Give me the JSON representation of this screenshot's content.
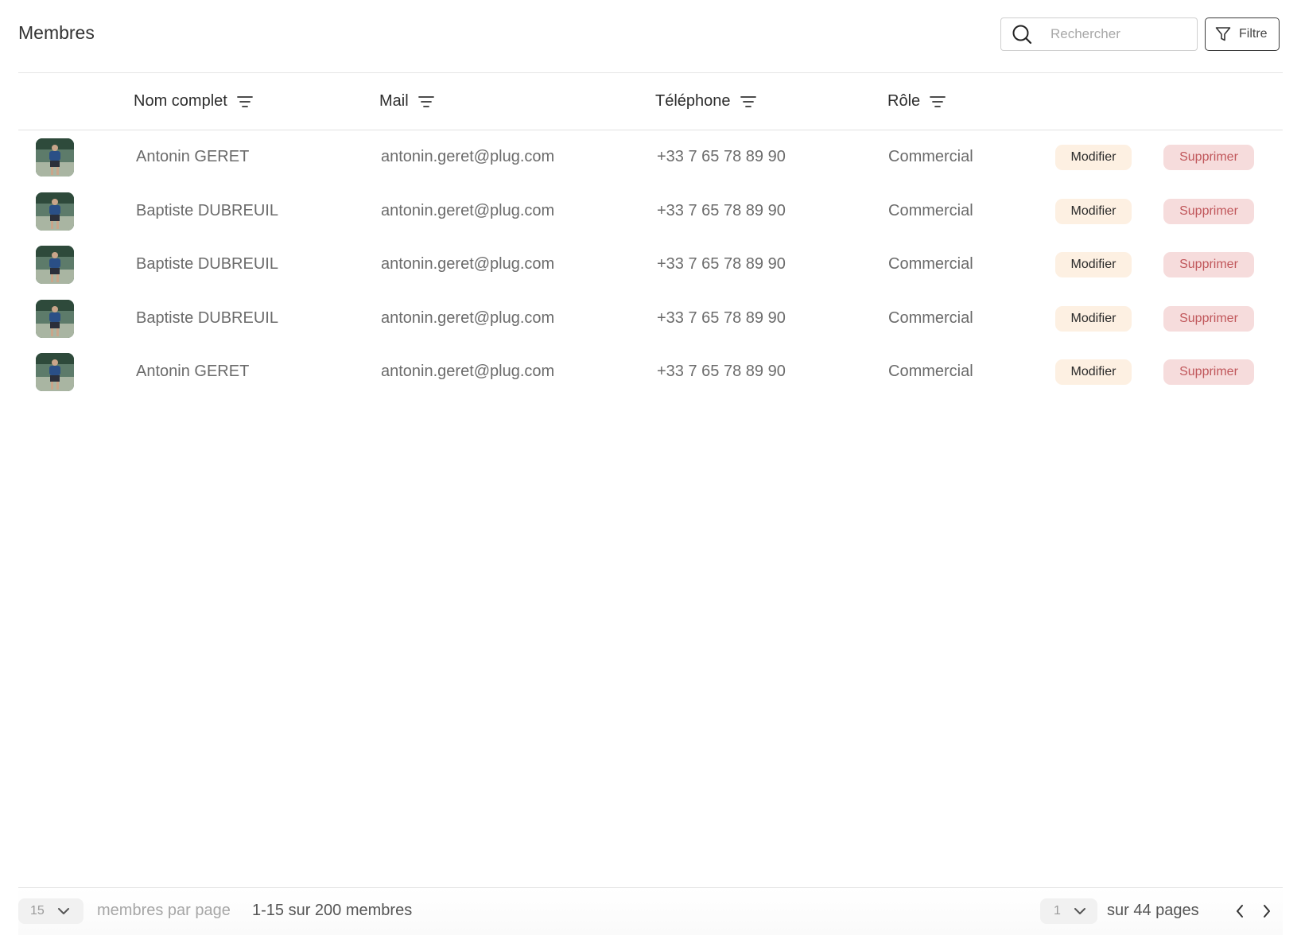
{
  "header": {
    "title": "Membres",
    "search_placeholder": "Rechercher",
    "filter_label": "Filtre"
  },
  "table": {
    "columns": [
      "Nom complet",
      "Mail",
      "Téléphone",
      "Rôle"
    ],
    "rows": [
      {
        "name": "Antonin GERET",
        "mail": "antonin.geret@plug.com",
        "phone": "+33 7 65 78 89 90",
        "role": "Commercial",
        "edit": "Modifier",
        "delete": "Supprimer"
      },
      {
        "name": "Baptiste DUBREUIL",
        "mail": "antonin.geret@plug.com",
        "phone": "+33 7 65 78 89 90",
        "role": "Commercial",
        "edit": "Modifier",
        "delete": "Supprimer"
      },
      {
        "name": "Baptiste DUBREUIL",
        "mail": "antonin.geret@plug.com",
        "phone": "+33 7 65 78 89 90",
        "role": "Commercial",
        "edit": "Modifier",
        "delete": "Supprimer"
      },
      {
        "name": "Baptiste DUBREUIL",
        "mail": "antonin.geret@plug.com",
        "phone": "+33 7 65 78 89 90",
        "role": "Commercial",
        "edit": "Modifier",
        "delete": "Supprimer"
      },
      {
        "name": "Antonin GERET",
        "mail": "antonin.geret@plug.com",
        "phone": "+33 7 65 78 89 90",
        "role": "Commercial",
        "edit": "Modifier",
        "delete": "Supprimer"
      }
    ]
  },
  "footer": {
    "per_page_value": "15",
    "per_page_label": "membres par page",
    "range_text": "1-15 sur 200 membres",
    "page_value": "1",
    "pages_label": "sur 44 pages"
  },
  "colors": {
    "modify_bg": "#fdf0e2",
    "delete_bg": "#f6dcdc",
    "delete_text": "#c0565a"
  },
  "icons": {
    "search": "search-icon",
    "filter": "filter-icon",
    "sort": "sort-lines-icon",
    "chevron": "chevron-down-icon",
    "prev": "chevron-left-icon",
    "next": "chevron-right-icon"
  }
}
